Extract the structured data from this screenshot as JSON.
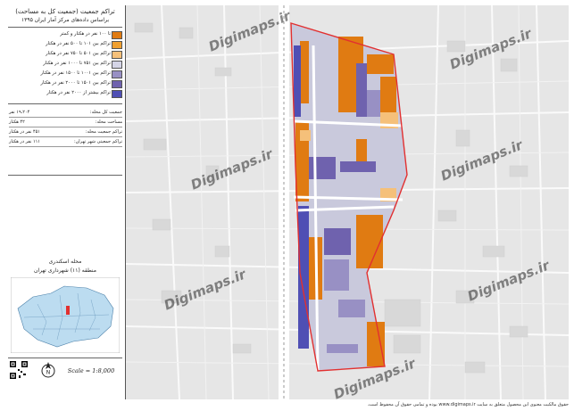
{
  "map": {
    "title_line1": "تراکم جمعیت (جمعیت کل به مساحت)",
    "title_line2": "براساس داده‌های مرکز آمار ایران ۱۳۹۵",
    "legend": [
      {
        "label": "تا ۱۰۰ نفر در هکتار و کمتر",
        "color": "#e07b12"
      },
      {
        "label": "تراکم بین ۱۰۱ تا ۵۰۰ نفر در هکتار",
        "color": "#f0a030"
      },
      {
        "label": "تراکم بین ۵۰۱ تا ۷۵۰ نفر در هکتار",
        "color": "#f5c07a"
      },
      {
        "label": "تراکم بین ۷۵۱ تا ۱۰۰۰ نفر در هکتار",
        "color": "#d4d4e6"
      },
      {
        "label": "تراکم بین ۱۰۰۱ تا ۱۵۰۰ نفر در هکتار",
        "color": "#9890c4"
      },
      {
        "label": "تراکم بین ۱۵۰۱ تا ۲۰۰۰ نفر در هکتار",
        "color": "#6f62ae"
      },
      {
        "label": "تراکم بیشتر از ۲۰۰۰ نفر در هکتار",
        "color": "#4f4fb4"
      }
    ],
    "stats": [
      {
        "key": "جمعیت کل محله:",
        "value": "۱۹،۲۰۴ نفر"
      },
      {
        "key": "مساحت محله:",
        "value": "۴۲ هکتار"
      },
      {
        "key": "تراکم جمعیت محله:",
        "value": "۴۵۱ نفر در هکتار"
      },
      {
        "key": "تراکم جمعیتی شهر تهران:",
        "value": "۱۱۱ نفر در هکتار"
      }
    ],
    "district_name": "محله اسکندری",
    "district_sub": "منطقه (۱۱) شهرداری تهران",
    "scale": "Scale = 1:8,000",
    "watermark": "Digimaps.ir",
    "footer": "حقوق مالکیت معنوی این محصول متعلق به سایت www.digimaps.ir بوده و تمامی حقوق آن محفوظ است."
  },
  "colors": {
    "orange": "#e07b12",
    "light_orange": "#f5c07a",
    "light_purple": "#d4d4e6",
    "mid_purple": "#9890c4",
    "dark_purple": "#6f62ae",
    "blue": "#4f4fb4",
    "boundary": "#e23030",
    "road": "#ffffff",
    "background": "#e6e6e6"
  }
}
